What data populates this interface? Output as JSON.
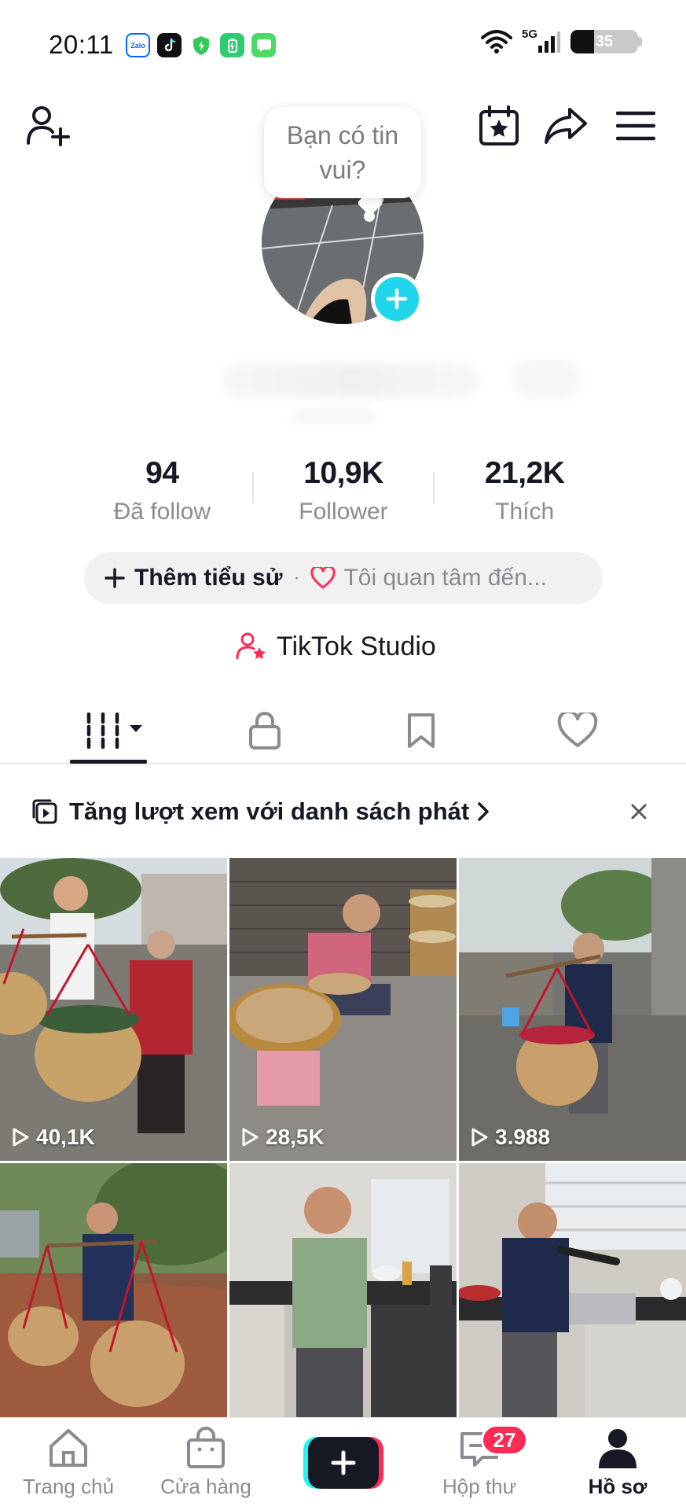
{
  "status_bar": {
    "time": "20:11",
    "network": "5G",
    "battery_level": "35",
    "battery_fraction": 0.35,
    "apps": [
      "zalo-app-icon",
      "tiktok-app-icon",
      "shield-app-icon",
      "battery-saver-app-icon",
      "messages-app-icon"
    ],
    "app_labels": {
      "zalo": "Zalo"
    }
  },
  "header": {
    "icons": [
      "add-friend-icon",
      "calendar-star-icon",
      "share-icon",
      "menu-icon"
    ]
  },
  "profile": {
    "bubble_text": "Bạn có tin vui?",
    "avatar_icon": "add-plus-icon"
  },
  "stats": [
    {
      "value": "94",
      "label": "Đã follow"
    },
    {
      "value": "10,9K",
      "label": "Follower"
    },
    {
      "value": "21,2K",
      "label": "Thích"
    }
  ],
  "bio": {
    "add_label": "Thêm tiểu sử",
    "separator": "·",
    "interest_label": "Tôi quan tâm đến..."
  },
  "studio": {
    "label": "TikTok Studio"
  },
  "tabs": [
    {
      "icon": "videos-grid-icon",
      "active": true
    },
    {
      "icon": "lock-icon",
      "active": false
    },
    {
      "icon": "bookmark-icon",
      "active": false
    },
    {
      "icon": "heart-icon",
      "active": false
    }
  ],
  "playlist_banner": {
    "label": "Tăng lượt xem với danh sách phát",
    "close_icon": "close-icon"
  },
  "videos": [
    {
      "views": "40,1K"
    },
    {
      "views": "28,5K"
    },
    {
      "views": "3.988"
    },
    {
      "views": ""
    },
    {
      "views": ""
    },
    {
      "views": ""
    }
  ],
  "bottom_nav": {
    "items": [
      {
        "label": "Trang chủ",
        "icon": "home-icon"
      },
      {
        "label": "Cửa hàng",
        "icon": "shopping-bag-icon"
      },
      {
        "label": "",
        "icon": "create-plus-icon"
      },
      {
        "label": "Hộp thư",
        "icon": "inbox-icon"
      },
      {
        "label": "Hồ sơ",
        "icon": "profile-icon"
      }
    ],
    "inbox_badge": "27"
  },
  "colors": {
    "accent_cyan": "#20d5ec",
    "accent_red": "#fe2c55",
    "text_primary": "#161823",
    "text_secondary": "#8a8b91"
  }
}
